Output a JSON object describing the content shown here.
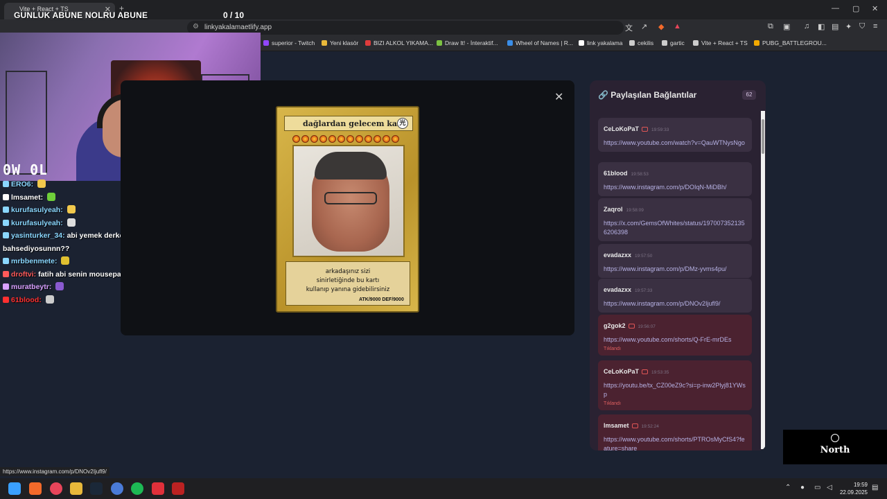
{
  "browser": {
    "tab_title": "Vite + React + TS",
    "address_left": "linkyakalama",
    "address_right": "etlify.app",
    "bookmarks": [
      {
        "label": "superior - Twitch",
        "color": "#9146ff"
      },
      {
        "label": "Yeni klasör",
        "color": "#e8b83a"
      },
      {
        "label": "BIZI ALKOL YIKAMA...",
        "color": "#e03c3c"
      },
      {
        "label": "Draw It! - İnteraktif...",
        "color": "#7cc242"
      },
      {
        "label": "Wheel of Names | R...",
        "color": "#3a8ee8"
      },
      {
        "label": "link yakalama",
        "color": "#ffffff"
      },
      {
        "label": "cekilis",
        "color": "#cccccc"
      },
      {
        "label": "gartic",
        "color": "#cccccc"
      },
      {
        "label": "Vite + React + TS",
        "color": "#cccccc"
      },
      {
        "label": "PUBG_BATTLEGROU...",
        "color": "#f2a900"
      }
    ]
  },
  "overlay": {
    "title": "GUNLUK ABUNE NOLRU ABUNE",
    "counter": "0  / 10",
    "cam_logo": "0W 0L"
  },
  "chat": [
    {
      "user": "ERO6:",
      "text": "",
      "color": "#8ad7ff"
    },
    {
      "user": "lmsamet:",
      "text": "",
      "color": "#ffffff"
    },
    {
      "user": "kurufasulyeah:",
      "text": "",
      "color": "#8ad7ff"
    },
    {
      "user": "kurufasulyeah:",
      "text": "",
      "color": "#8ad7ff"
    },
    {
      "user": "yasinturker_34:",
      "text": "abi yemek derken ne tarz yemeklerden bahsediyosunnn??",
      "color": "#8ad7ff"
    },
    {
      "user": "mrbbenmete:",
      "text": "",
      "color": "#8ad7ff"
    },
    {
      "user": "droftvi:",
      "text": "fatih abi senin mousepad hangisi",
      "color": "#ff5a5a"
    },
    {
      "user": "muratbeytr:",
      "text": "",
      "color": "#d8a0ff"
    },
    {
      "user": "61blood:",
      "text": "",
      "color": "#ff3030"
    }
  ],
  "card": {
    "title": "dağlardan gelecem kartı",
    "text_line1": "arkadaşınız sizi",
    "text_line2": "sinirletiğinde bu kartı",
    "text_line3": "kullanıp yanına gidebilirsiniz",
    "stats": "ATK/9000   DEF/9000",
    "stars": 12
  },
  "panel": {
    "title": "Paylaşılan Bağlantılar",
    "count": "62",
    "items": [
      {
        "user": "CeLoKoPaT",
        "time": "19:59:33",
        "url": "https://www.youtube.com/watch?v=QauWTNysNgo",
        "clicked": ""
      },
      {
        "user": "61blood",
        "time": "19:58:53",
        "url": "https://www.instagram.com/p/DOIqN-MiDBh/",
        "clicked": ""
      },
      {
        "user": "Zaqrol",
        "time": "19:58:09",
        "url": "https://x.com/GemsOfWhites/status/1970073521356206398",
        "clicked": ""
      },
      {
        "user": "evadazxx",
        "time": "19:57:50",
        "url": "https://www.instagram.com/p/DMz-yvms4pu/",
        "clicked": ""
      },
      {
        "user": "evadazxx",
        "time": "19:57:33",
        "url": "https://www.instagram.com/p/DNOv2Ijufl9/",
        "clicked": ""
      },
      {
        "user": "g2gok2",
        "time": "19:56:07",
        "url": "https://www.youtube.com/shorts/Q-FrE-mrDEs",
        "clicked": "Tıklandı"
      },
      {
        "user": "CeLoKoPaT",
        "time": "19:53:35",
        "url": "https://youtu.be/tx_CZ00eZ9c?si=p-inw2Plyj81YWsp",
        "clicked": "Tıklandı"
      },
      {
        "user": "lmsamet",
        "time": "19:52:24",
        "url": "https://www.youtube.com/shorts/PTROsMyCfS4?feature=share",
        "clicked": ""
      }
    ]
  },
  "north": {
    "label": "North"
  },
  "status_url": "https://www.instagram.com/p/DNOv2Ijufl9/",
  "taskbar": {
    "time": "19:59",
    "date": "22.09.2025"
  }
}
